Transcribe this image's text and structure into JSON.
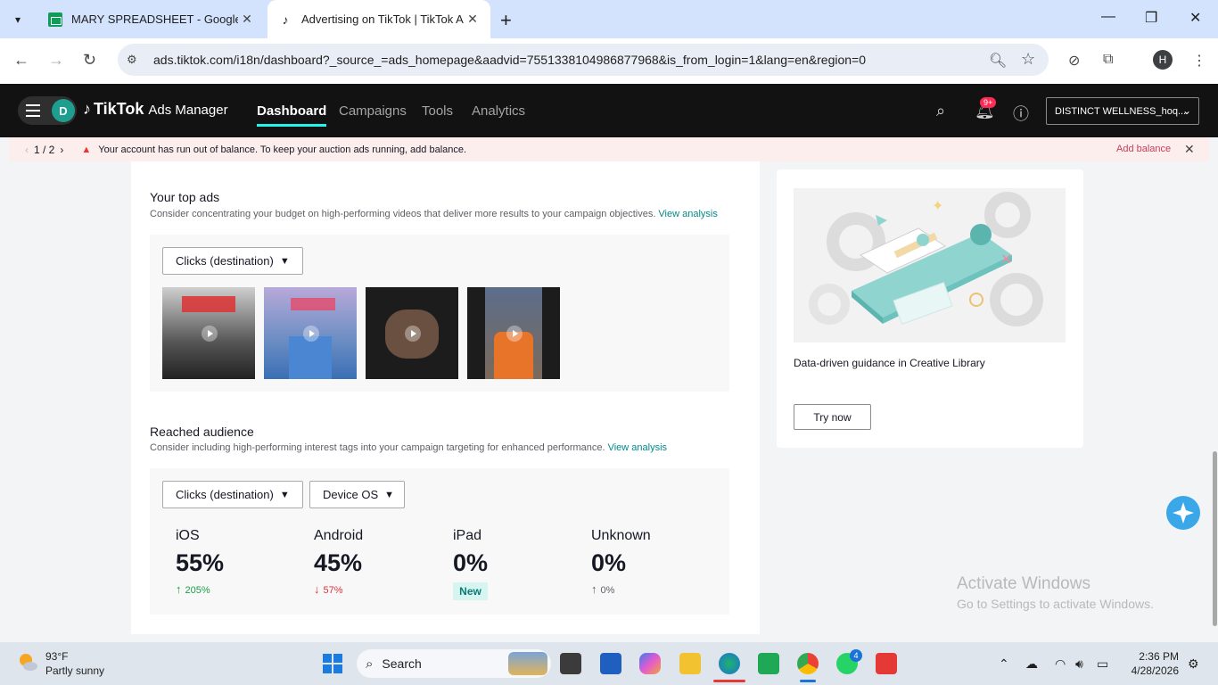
{
  "browser": {
    "tabs": [
      {
        "title": "MARY SPREADSHEET - Google She",
        "close": "✕"
      },
      {
        "title": "Advertising on TikTok | TikTok Ads",
        "close": "✕"
      }
    ],
    "new_tab": "+",
    "url": "ads.tiktok.com/i18n/dashboard?_source_=ads_homepage&aadvid=7551338104986877968&is_from_login=1&lang=en&region=0",
    "profile_initial": "H"
  },
  "header": {
    "avatar_initial": "D",
    "brand_main": "TikTok",
    "brand_sub": "Ads Manager",
    "nav": [
      "Dashboard",
      "Campaigns",
      "Tools",
      "Analytics"
    ],
    "notifications_badge": "9+",
    "account": "DISTINCT WELLNESS_hoq..."
  },
  "alert": {
    "pager": "1 / 2",
    "message": "Your account has run out of balance. To keep your auction ads running, add balance.",
    "action": "Add balance"
  },
  "top_ads": {
    "title": "Your top ads",
    "subtitle": "Consider concentrating your budget on high-performing videos that deliver more results to your campaign objectives.",
    "link": "View analysis",
    "metric": "Clicks (destination)"
  },
  "reached": {
    "title": "Reached audience",
    "subtitle": "Consider including high-performing interest tags into your campaign targeting for enhanced performance.",
    "link": "View analysis",
    "metric": "Clicks (destination)",
    "dimension": "Device OS",
    "stats": [
      {
        "label": "iOS",
        "value": "55%",
        "delta": "205%",
        "dir": "up"
      },
      {
        "label": "Android",
        "value": "45%",
        "delta": "57%",
        "dir": "down"
      },
      {
        "label": "iPad",
        "value": "0%",
        "badge": "New"
      },
      {
        "label": "Unknown",
        "value": "0%",
        "delta": "0%",
        "dir": "flat"
      }
    ]
  },
  "creative": {
    "title": "Data-driven guidance in Creative Library",
    "button": "Try now"
  },
  "watermark": {
    "line1": "Activate Windows",
    "line2": "Go to Settings to activate Windows."
  },
  "taskbar": {
    "temp": "93°F",
    "condition": "Partly sunny",
    "search": "Search",
    "whatsapp_badge": "4",
    "time": "2:36 PM",
    "date": "4/28/2026"
  },
  "colors": {
    "accent": "#25f4ee",
    "link": "#008a8a",
    "up": "#1a9e4a",
    "down": "#e0313a"
  }
}
